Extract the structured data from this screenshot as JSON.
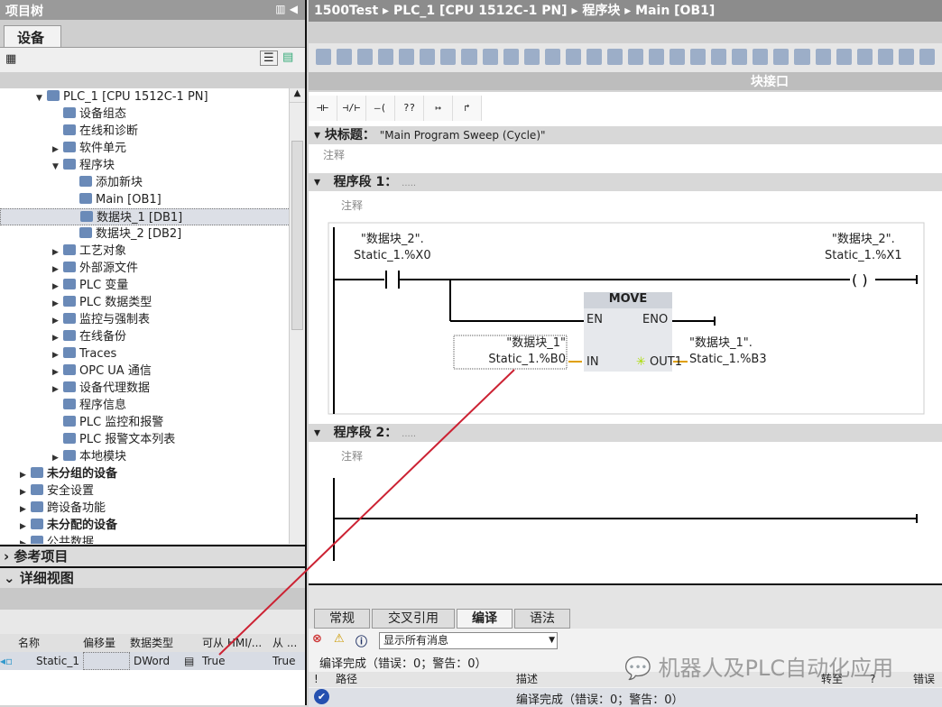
{
  "project_tree": {
    "title": "项目树",
    "tab": "设备",
    "items": [
      {
        "label": "PLC_1 [CPU 1512C-1 PN]",
        "level": 1,
        "arrow": "down"
      },
      {
        "label": "设备组态",
        "level": 2,
        "arrow": ""
      },
      {
        "label": "在线和诊断",
        "level": 2,
        "arrow": ""
      },
      {
        "label": "软件单元",
        "level": 2,
        "arrow": "right"
      },
      {
        "label": "程序块",
        "level": 2,
        "arrow": "down"
      },
      {
        "label": "添加新块",
        "level": 3,
        "arrow": ""
      },
      {
        "label": "Main [OB1]",
        "level": 3,
        "arrow": ""
      },
      {
        "label": "数据块_1 [DB1]",
        "level": 3,
        "arrow": "",
        "selected": true
      },
      {
        "label": "数据块_2 [DB2]",
        "level": 3,
        "arrow": ""
      },
      {
        "label": "工艺对象",
        "level": 2,
        "arrow": "right"
      },
      {
        "label": "外部源文件",
        "level": 2,
        "arrow": "right"
      },
      {
        "label": "PLC 变量",
        "level": 2,
        "arrow": "right"
      },
      {
        "label": "PLC 数据类型",
        "level": 2,
        "arrow": "right"
      },
      {
        "label": "监控与强制表",
        "level": 2,
        "arrow": "right"
      },
      {
        "label": "在线备份",
        "level": 2,
        "arrow": "right"
      },
      {
        "label": "Traces",
        "level": 2,
        "arrow": "right"
      },
      {
        "label": "OPC UA 通信",
        "level": 2,
        "arrow": "right"
      },
      {
        "label": "设备代理数据",
        "level": 2,
        "arrow": "right"
      },
      {
        "label": "程序信息",
        "level": 2,
        "arrow": ""
      },
      {
        "label": "PLC 监控和报警",
        "level": 2,
        "arrow": ""
      },
      {
        "label": "PLC 报警文本列表",
        "level": 2,
        "arrow": ""
      },
      {
        "label": "本地模块",
        "level": 2,
        "arrow": "right"
      },
      {
        "label": "未分组的设备",
        "level": 0,
        "arrow": "right",
        "bold": true
      },
      {
        "label": "安全设置",
        "level": 0,
        "arrow": "right"
      },
      {
        "label": "跨设备功能",
        "level": 0,
        "arrow": "right"
      },
      {
        "label": "未分配的设备",
        "level": 0,
        "arrow": "right",
        "bold": true
      },
      {
        "label": "公共数据",
        "level": 0,
        "arrow": "right"
      }
    ]
  },
  "reference": {
    "title": "参考项目"
  },
  "detail": {
    "title": "详细视图",
    "columns": [
      "名称",
      "偏移量",
      "数据类型",
      "可从 HMI/...",
      "从 ..."
    ],
    "row": {
      "name": "Static_1",
      "offset": "",
      "type": "DWord",
      "hmi": "True",
      "from": "True"
    }
  },
  "breadcrumb": [
    "1500Test",
    "PLC_1 [CPU 1512C-1 PN]",
    "程序块",
    "Main [OB1]"
  ],
  "interface_label": "块接口",
  "ladder_tools": [
    "⊣⊢",
    "⊣/⊢",
    "–( )–",
    "??",
    "↦",
    "↱"
  ],
  "block": {
    "title_label": "块标题：",
    "title": "\"Main Program Sweep (Cycle)\"",
    "comment": "注释"
  },
  "networks": [
    {
      "label": "程序段 1：",
      "dots": ".....",
      "comment": "注释",
      "contact": {
        "l1": "\"数据块_2\".",
        "l2": "Static_1.%X0"
      },
      "coil": {
        "l1": "\"数据块_2\".",
        "l2": "Static_1.%X1"
      },
      "move": {
        "name": "MOVE",
        "en": "EN",
        "eno": "ENO",
        "in": "IN",
        "out": "OUT1",
        "in_l1": "\"数据块_1\"",
        "in_l2": "Static_1.%B0",
        "out_l1": "\"数据块_1\".",
        "out_l2": "Static_1.%B3"
      }
    },
    {
      "label": "程序段 2：",
      "dots": ".....",
      "comment": "注释"
    }
  ],
  "inspector": {
    "tabs": [
      "常规",
      "交叉引用",
      "编译",
      "语法"
    ],
    "active": "编译",
    "filter": "显示所有消息",
    "status": "编译完成（错误：0；警告：0）",
    "columns": [
      "!",
      "路径",
      "描述",
      "转至",
      "?",
      "错误"
    ],
    "row_desc": "编译完成（错误：0；警告：0）"
  },
  "watermark": "机器人及PLC自动化应用",
  "colors": {
    "annotation_line": "#cc2233",
    "selected": "#dcdfe6"
  }
}
